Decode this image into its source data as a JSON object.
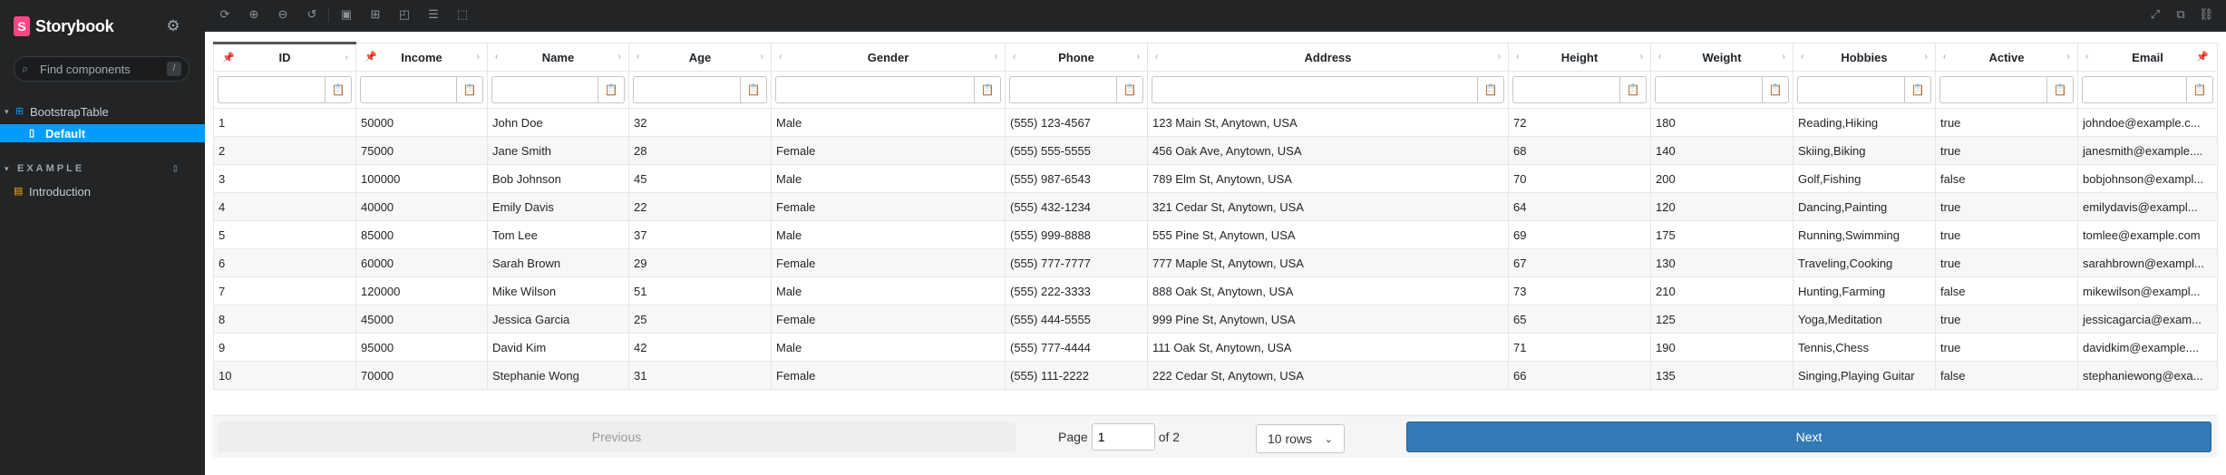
{
  "sidebar": {
    "brand": "Storybook",
    "search_placeholder": "Find components",
    "search_shortcut": "/",
    "tree": [
      {
        "label": "BootstrapTable"
      },
      {
        "label": "Default"
      },
      {
        "label": "EXAMPLE"
      },
      {
        "label": "Introduction"
      }
    ]
  },
  "toolbar": {
    "icons": [
      "reload-icon",
      "zoom-in-icon",
      "zoom-out-icon",
      "zoom-reset-icon",
      "background-icon",
      "grid-icon",
      "measure-icon",
      "outline-icon",
      "viewport-icon",
      "fullscreen-icon",
      "open-new-tab-icon",
      "copy-link-icon"
    ]
  },
  "table": {
    "columns": [
      "ID",
      "Income",
      "Name",
      "Age",
      "Gender",
      "Phone",
      "Address",
      "Height",
      "Weight",
      "Hobbies",
      "Active",
      "Email"
    ],
    "rows": [
      [
        "1",
        "50000",
        "John Doe",
        "32",
        "Male",
        "(555) 123-4567",
        "123 Main St, Anytown, USA",
        "72",
        "180",
        "Reading,Hiking",
        "true",
        "johndoe@example.c..."
      ],
      [
        "2",
        "75000",
        "Jane Smith",
        "28",
        "Female",
        "(555) 555-5555",
        "456 Oak Ave, Anytown, USA",
        "68",
        "140",
        "Skiing,Biking",
        "true",
        "janesmith@example...."
      ],
      [
        "3",
        "100000",
        "Bob Johnson",
        "45",
        "Male",
        "(555) 987-6543",
        "789 Elm St, Anytown, USA",
        "70",
        "200",
        "Golf,Fishing",
        "false",
        "bobjohnson@exampl..."
      ],
      [
        "4",
        "40000",
        "Emily Davis",
        "22",
        "Female",
        "(555) 432-1234",
        "321 Cedar St, Anytown, USA",
        "64",
        "120",
        "Dancing,Painting",
        "true",
        "emilydavis@exampl..."
      ],
      [
        "5",
        "85000",
        "Tom Lee",
        "37",
        "Male",
        "(555) 999-8888",
        "555 Pine St, Anytown, USA",
        "69",
        "175",
        "Running,Swimming",
        "true",
        "tomlee@example.com"
      ],
      [
        "6",
        "60000",
        "Sarah Brown",
        "29",
        "Female",
        "(555) 777-7777",
        "777 Maple St, Anytown, USA",
        "67",
        "130",
        "Traveling,Cooking",
        "true",
        "sarahbrown@exampl..."
      ],
      [
        "7",
        "120000",
        "Mike Wilson",
        "51",
        "Male",
        "(555) 222-3333",
        "888 Oak St, Anytown, USA",
        "73",
        "210",
        "Hunting,Farming",
        "false",
        "mikewilson@exampl..."
      ],
      [
        "8",
        "45000",
        "Jessica Garcia",
        "25",
        "Female",
        "(555) 444-5555",
        "999 Pine St, Anytown, USA",
        "65",
        "125",
        "Yoga,Meditation",
        "true",
        "jessicagarcia@exam..."
      ],
      [
        "9",
        "95000",
        "David Kim",
        "42",
        "Male",
        "(555) 777-4444",
        "111 Oak St, Anytown, USA",
        "71",
        "190",
        "Tennis,Chess",
        "true",
        "davidkim@example...."
      ],
      [
        "10",
        "70000",
        "Stephanie Wong",
        "31",
        "Female",
        "(555) 111-2222",
        "222 Cedar St, Anytown, USA",
        "66",
        "135",
        "Singing,Playing Guitar",
        "false",
        "stephaniewong@exa..."
      ]
    ]
  },
  "pagination": {
    "previous_label": "Previous",
    "page_label": "Page",
    "page_value": "1",
    "of_label": "of 2",
    "rows_label": "10 rows",
    "next_label": "Next"
  },
  "colors": {
    "brand": "#ff4785",
    "selected": "#029cfd",
    "next_button": "#337ab7"
  }
}
